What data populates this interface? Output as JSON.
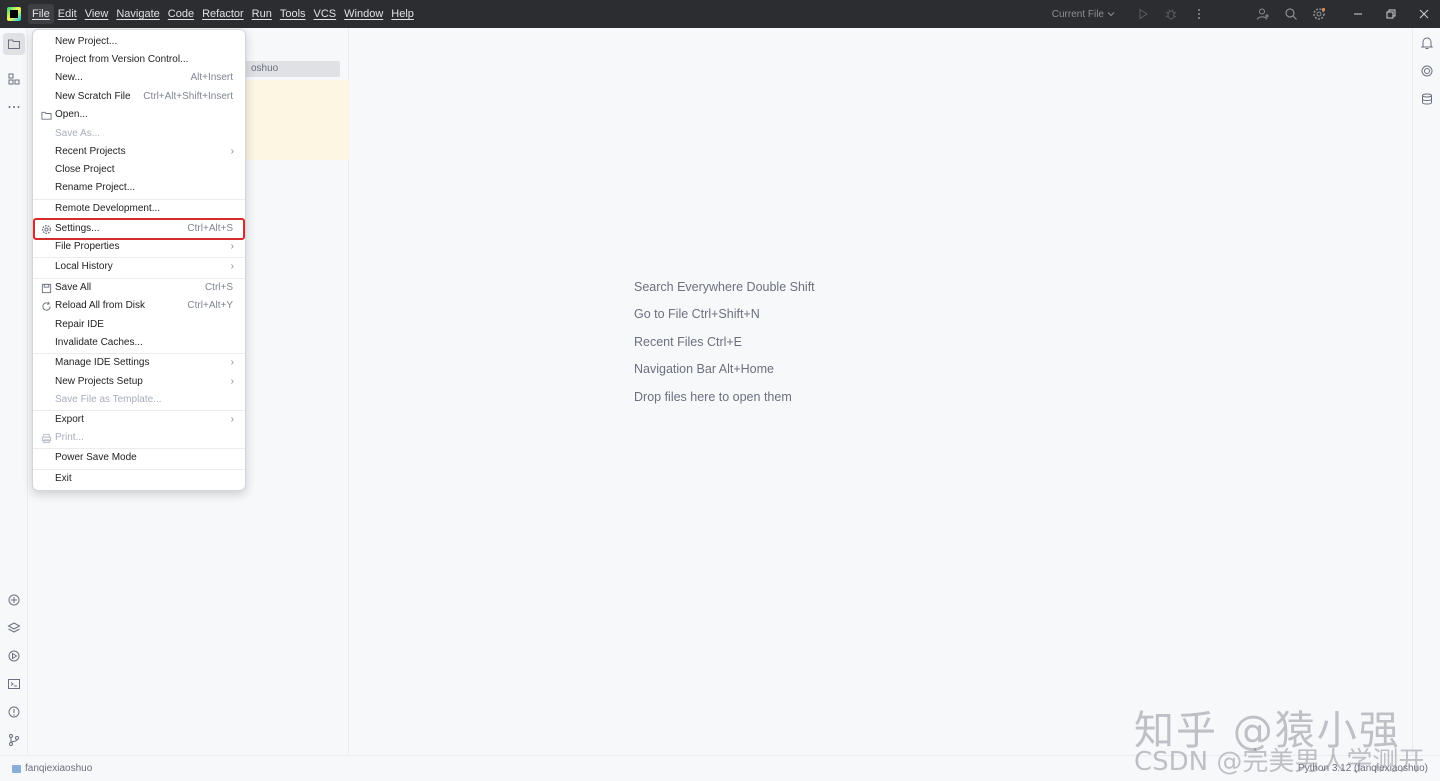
{
  "menubar": {
    "items": [
      "File",
      "Edit",
      "View",
      "Navigate",
      "Code",
      "Refactor",
      "Run",
      "Tools",
      "VCS",
      "Window",
      "Help"
    ]
  },
  "toolbar": {
    "run_config": "Current File"
  },
  "project_panel": {
    "selected_row": "oshuo"
  },
  "file_menu": {
    "items": [
      {
        "label": "New Project...",
        "shortcut": ""
      },
      {
        "label": "Project from Version Control...",
        "shortcut": ""
      },
      {
        "label": "New...",
        "shortcut": "Alt+Insert"
      },
      {
        "label": "New Scratch File",
        "shortcut": "Ctrl+Alt+Shift+Insert"
      },
      {
        "label": "Open...",
        "shortcut": ""
      },
      {
        "label": "Save As...",
        "shortcut": ""
      },
      {
        "label": "Recent Projects",
        "shortcut": ""
      },
      {
        "label": "Close Project",
        "shortcut": ""
      },
      {
        "label": "Rename Project...",
        "shortcut": ""
      },
      {
        "label": "Remote Development...",
        "shortcut": ""
      },
      {
        "label": "Settings...",
        "shortcut": "Ctrl+Alt+S"
      },
      {
        "label": "File Properties",
        "shortcut": ""
      },
      {
        "label": "Local History",
        "shortcut": ""
      },
      {
        "label": "Save All",
        "shortcut": "Ctrl+S"
      },
      {
        "label": "Reload All from Disk",
        "shortcut": "Ctrl+Alt+Y"
      },
      {
        "label": "Repair IDE",
        "shortcut": ""
      },
      {
        "label": "Invalidate Caches...",
        "shortcut": ""
      },
      {
        "label": "Manage IDE Settings",
        "shortcut": ""
      },
      {
        "label": "New Projects Setup",
        "shortcut": ""
      },
      {
        "label": "Save File as Template...",
        "shortcut": ""
      },
      {
        "label": "Export",
        "shortcut": ""
      },
      {
        "label": "Print...",
        "shortcut": ""
      },
      {
        "label": "Power Save Mode",
        "shortcut": ""
      },
      {
        "label": "Exit",
        "shortcut": ""
      }
    ]
  },
  "editor_hints": [
    "Search Everywhere Double Shift",
    "Go to File Ctrl+Shift+N",
    "Recent Files Ctrl+E",
    "Navigation Bar Alt+Home",
    "Drop files here to open them"
  ],
  "statusbar": {
    "project": "fanqiexiaoshuo",
    "interpreter": "Python 3.12 (fanqiexiaoshuo)"
  },
  "watermark": {
    "main": "知乎 @猿小强",
    "sub": "CSDN @完美男人学测开"
  },
  "colors": {
    "titlebar_bg": "#2b2d30",
    "panel_bg": "#f7f8fa",
    "highlight_outline": "#d62b2b",
    "selected_row_bg": "#dfe1e5"
  }
}
